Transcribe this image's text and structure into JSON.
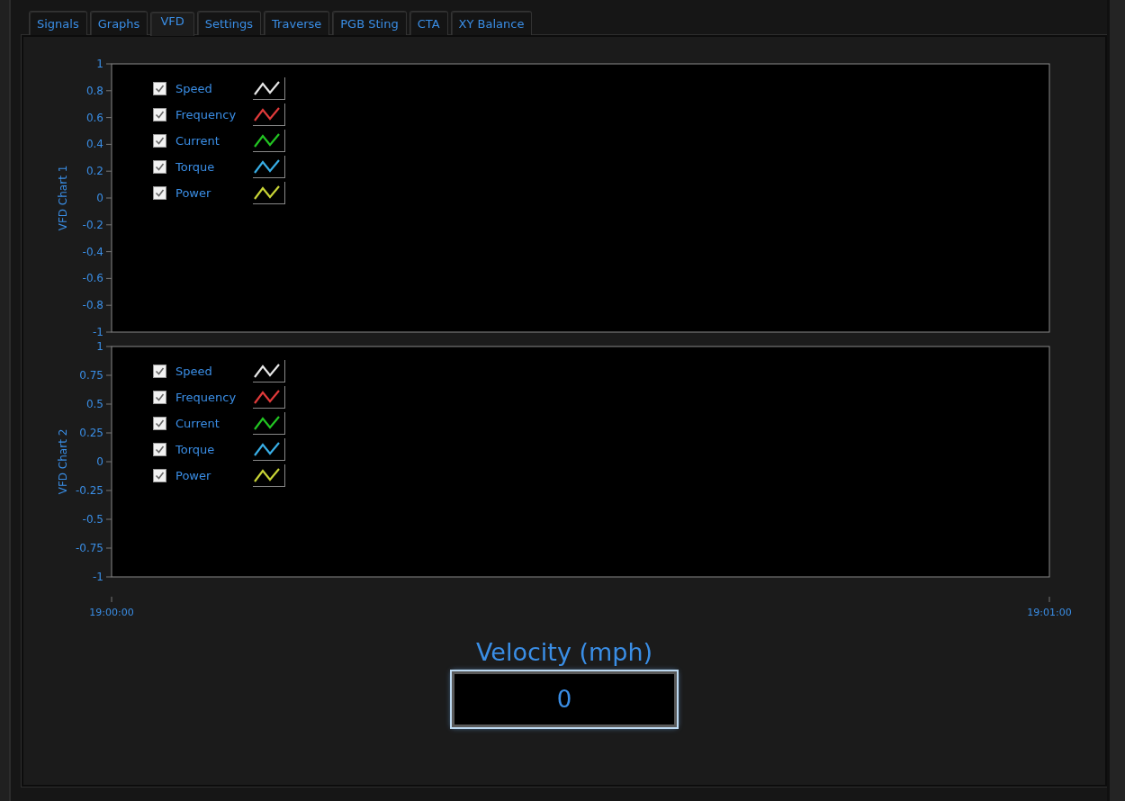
{
  "tabs": [
    {
      "label": "Signals",
      "selected": false
    },
    {
      "label": "Graphs",
      "selected": false
    },
    {
      "label": "VFD",
      "selected": true
    },
    {
      "label": "Settings",
      "selected": false
    },
    {
      "label": "Traverse",
      "selected": false
    },
    {
      "label": "PGB Sting",
      "selected": false
    },
    {
      "label": "CTA",
      "selected": false
    },
    {
      "label": "XY Balance",
      "selected": false
    }
  ],
  "charts": [
    {
      "ylabel": "VFD Chart 1",
      "y_ticks": [
        "1",
        "0.8",
        "0.6",
        "0.4",
        "0.2",
        "0",
        "-0.2",
        "-0.4",
        "-0.6",
        "-0.8",
        "-1"
      ],
      "legend": [
        {
          "label": "Speed",
          "color": "#e6e6e6",
          "checked": true
        },
        {
          "label": "Frequency",
          "color": "#e03a3a",
          "checked": true
        },
        {
          "label": "Current",
          "color": "#22c422",
          "checked": true
        },
        {
          "label": "Torque",
          "color": "#38aee6",
          "checked": true
        },
        {
          "label": "Power",
          "color": "#c8d436",
          "checked": true
        }
      ]
    },
    {
      "ylabel": "VFD Chart 2",
      "y_ticks": [
        "1",
        "0.75",
        "0.5",
        "0.25",
        "0",
        "-0.25",
        "-0.5",
        "-0.75",
        "-1"
      ],
      "legend": [
        {
          "label": "Speed",
          "color": "#e6e6e6",
          "checked": true
        },
        {
          "label": "Frequency",
          "color": "#e03a3a",
          "checked": true
        },
        {
          "label": "Current",
          "color": "#22c422",
          "checked": true
        },
        {
          "label": "Torque",
          "color": "#38aee6",
          "checked": true
        },
        {
          "label": "Power",
          "color": "#c8d436",
          "checked": true
        }
      ]
    }
  ],
  "x_ticks": [
    "19:00:00",
    "19:01:00"
  ],
  "velocity": {
    "label": "Velocity (mph)",
    "value": "0"
  }
}
